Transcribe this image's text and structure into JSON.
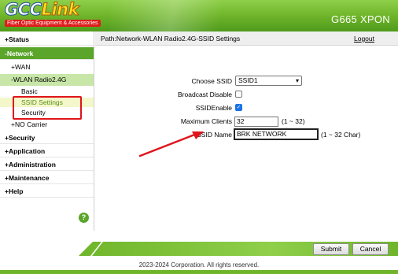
{
  "header": {
    "brand_part1": "GCC",
    "brand_part2": "Link",
    "tagline": "Fiber Optic Equipment & Accessories",
    "model": "G665 XPON"
  },
  "breadcrumb": {
    "path": "Path:Network-WLAN Radio2.4G-SSID Settings",
    "logout": "Logout"
  },
  "sidebar": {
    "status": "+Status",
    "network": "-Network",
    "wan": "+WAN",
    "wlan": "-WLAN Radio2.4G",
    "basic": "Basic",
    "ssid_settings": "SSID Settings",
    "security_sub": "Security",
    "no_carrier": "+NO Carrier",
    "security": "+Security",
    "application": "+Application",
    "administration": "+Administration",
    "maintenance": "+Maintenance",
    "help": "+Help",
    "help_icon": "?"
  },
  "form": {
    "choose_ssid_label": "Choose SSID",
    "choose_ssid_value": "SSID1",
    "broadcast_disable_label": "Broadcast Disable",
    "broadcast_disable_checked": false,
    "ssid_enable_label": "SSIDEnable",
    "ssid_enable_checked": true,
    "max_clients_label": "Maximum Clients",
    "max_clients_value": "32",
    "max_clients_range": "(1 ~ 32)",
    "ssid_name_label": "SSID Name",
    "ssid_name_value": "BRK NETWORK",
    "ssid_name_range": "(1 ~ 32 Char)"
  },
  "buttons": {
    "submit": "Submit",
    "cancel": "Cancel"
  },
  "footer": {
    "copyright": "2023-2024 Corporation. All rights reserved."
  },
  "annotations": {
    "highlight_color": "#e0151b"
  }
}
